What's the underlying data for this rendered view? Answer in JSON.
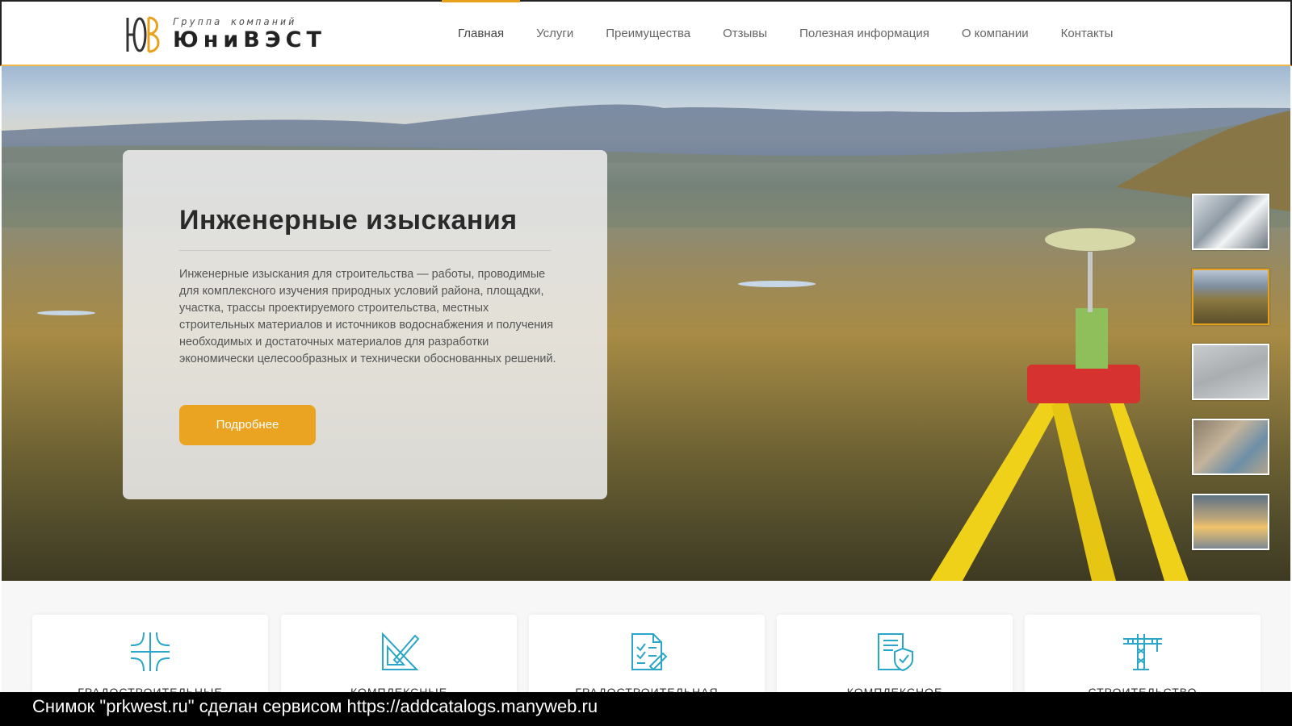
{
  "logo": {
    "tagline": "Группа компаний",
    "name": "ЮниВЭСТ"
  },
  "nav": {
    "items": [
      {
        "label": "Главная",
        "active": true
      },
      {
        "label": "Услуги",
        "active": false
      },
      {
        "label": "Преимущества",
        "active": false
      },
      {
        "label": "Отзывы",
        "active": false
      },
      {
        "label": "Полезная информация",
        "active": false
      },
      {
        "label": "О компании",
        "active": false
      },
      {
        "label": "Контакты",
        "active": false
      }
    ]
  },
  "hero": {
    "title": "Инженерные изыскания",
    "description": "Инженерные изыскания для строительства — работы, проводимые для комплексного изучения природных условий района, площадки, участка, трассы проектируемого строительства, местных строительных материалов и источников водоснабжения и получения необходимых и достаточных материалов для разработки экономически целесообразных и технически обоснованных решений.",
    "button_label": "Подробнее",
    "thumbnails": [
      "thumb-1",
      "thumb-2",
      "thumb-3",
      "thumb-4",
      "thumb-5"
    ]
  },
  "services": {
    "cards": [
      {
        "icon": "road-junction-icon",
        "label": "ГРАДОСТРОИТЕЛЬНЫЕ"
      },
      {
        "icon": "drafting-tools-icon",
        "label": "КОМПЛЕКСНЫЕ"
      },
      {
        "icon": "document-checklist-icon",
        "label": "ГРАДОСТРОИТЕЛЬНАЯ"
      },
      {
        "icon": "certificate-shield-icon",
        "label": "КОМПЛЕКСНОЕ"
      },
      {
        "icon": "tower-crane-icon",
        "label": "СТРОИТЕЛЬСТВО"
      }
    ]
  },
  "caption": {
    "text": "Снимок \"prkwest.ru\" сделан сервисом https://addcatalogs.manyweb.ru"
  },
  "colors": {
    "accent": "#eba421",
    "icon": "#2aa6c8",
    "caption_bg": "#000000"
  }
}
